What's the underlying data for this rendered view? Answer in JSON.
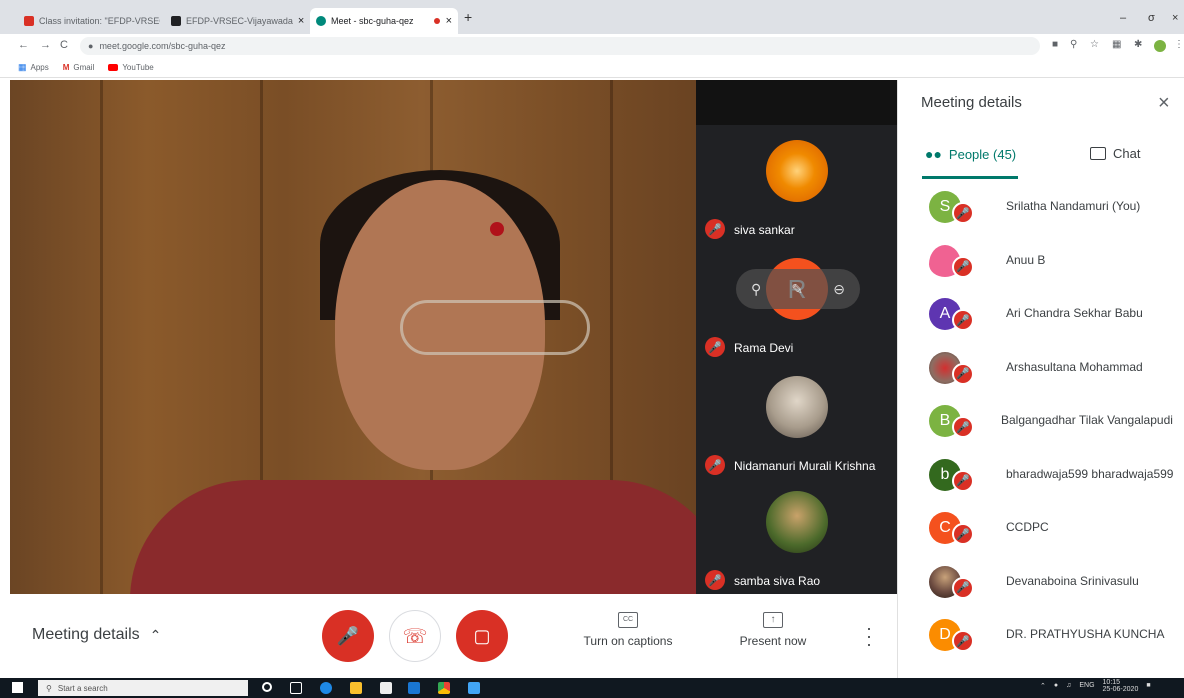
{
  "browser": {
    "tabs": [
      {
        "label": "Class invitation: \"EFDP-VRSEC-V",
        "favicon_color": "#d93025",
        "favicon": "gmail-icon",
        "close": "×"
      },
      {
        "label": "EFDP-VRSEC-Vijayawada",
        "favicon_color": "#202124",
        "favicon": "classroom-icon",
        "close": "×"
      },
      {
        "label": "Meet - sbc-guha-qez",
        "favicon_color": "#00897b",
        "favicon": "meet-icon",
        "close": "×"
      }
    ],
    "new_tab": "+",
    "window_controls": [
      "–",
      "σ",
      "×"
    ],
    "nav": {
      "back": "←",
      "forward": "→",
      "reload": "C"
    },
    "url": "meet.google.com/sbc-guha-qez",
    "bookmarks": [
      {
        "label": "Apps",
        "icon": "apps-icon",
        "color": "#1a73e8"
      },
      {
        "label": "Gmail",
        "icon": "gmail-icon",
        "color": "#d93025"
      },
      {
        "label": "YouTube",
        "icon": "youtube-icon",
        "color": "#ff0000"
      }
    ]
  },
  "strip": {
    "tiles": [
      {
        "name": "siva sankar",
        "avatar_color": "#e8710a"
      },
      {
        "name": "Rama Devi",
        "avatar_color": "#f4511e",
        "initial": "R"
      },
      {
        "name": "Nidamanuri Murali Krishna",
        "avatar_color": "#c9c4bd"
      },
      {
        "name": "samba siva Rao",
        "avatar_color": "#4c6a2b"
      }
    ]
  },
  "bottom_bar": {
    "meeting_details": "Meeting details",
    "captions_label": "Turn on captions",
    "captions_icon": "CC",
    "present_label": "Present now",
    "present_icon": "↑"
  },
  "panel": {
    "title": "Meeting details",
    "close": "×",
    "people_tab": "People (45)",
    "chat_tab": "Chat",
    "accent": "#00796b",
    "people": [
      {
        "name": "Srilatha Nandamuri (You)",
        "initial": "S",
        "color": "#7cb342"
      },
      {
        "name": "Anuu B",
        "initial": "",
        "color": "#f06292"
      },
      {
        "name": "Ari Chandra Sekhar Babu",
        "initial": "A",
        "color": "#5e35b1"
      },
      {
        "name": "Arshasultana Mohammad",
        "initial": "",
        "color": "#8d6e63"
      },
      {
        "name": "Balgangadhar Tilak Vangalapudi",
        "initial": "B",
        "color": "#7cb342"
      },
      {
        "name": "bharadwaja599 bharadwaja599",
        "initial": "b",
        "color": "#33691e"
      },
      {
        "name": "CCDPC",
        "initial": "C",
        "color": "#f4511e"
      },
      {
        "name": "Devanaboina Srinivasulu",
        "initial": "",
        "color": "#6d4c41"
      },
      {
        "name": "DR. PRATHYUSHA KUNCHA",
        "initial": "D",
        "color": "#fb8c00"
      }
    ]
  },
  "taskbar": {
    "search_placeholder": "Start a search",
    "lang": "ENG",
    "time": "10:15",
    "date": "25-06-2020"
  }
}
